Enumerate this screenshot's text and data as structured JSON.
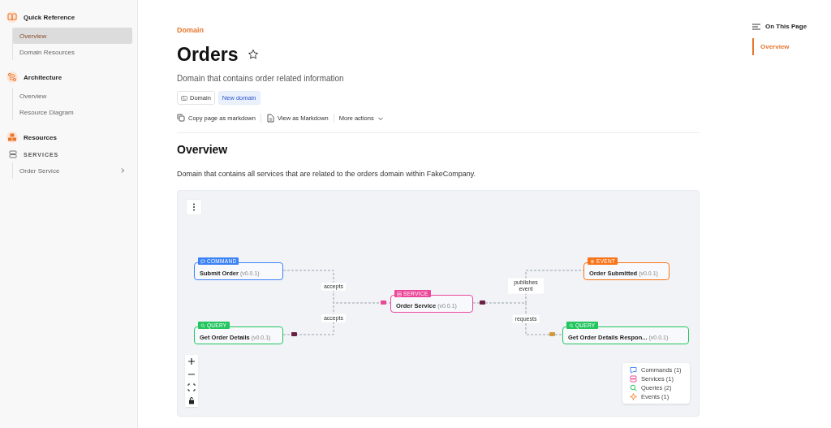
{
  "sidebar": {
    "sections": [
      {
        "kind": "book",
        "title": "Quick Reference",
        "items": [
          {
            "label": "Overview",
            "selected": true
          },
          {
            "label": "Domain Resources",
            "selected": false
          }
        ]
      },
      {
        "kind": "route",
        "title": "Architecture",
        "items": [
          {
            "label": "Overview",
            "selected": false
          },
          {
            "label": "Resource Diagram",
            "selected": false
          }
        ]
      },
      {
        "kind": "resources",
        "title": "Resources",
        "groups": [
          {
            "label": "SERVICES",
            "items": [
              {
                "label": "Order Service",
                "selected": false,
                "expanded": false
              }
            ]
          }
        ]
      }
    ]
  },
  "page": {
    "breadcrumb": "Domain",
    "title": "Orders",
    "starred": false,
    "description": "Domain that contains order related information",
    "tags": [
      {
        "kind": "outline",
        "label": "Domain"
      },
      {
        "kind": "highlight",
        "label": "New domain"
      }
    ],
    "actions": [
      {
        "kind": "copy",
        "label": "Copy page as markdown"
      },
      {
        "kind": "file",
        "label": "View as Markdown"
      },
      {
        "kind": "menu",
        "label": "More actions"
      }
    ],
    "section_heading": "Overview",
    "paragraph": "Domain that contains all services that are related to the orders domain within FakeCompany.",
    "diagram": {
      "nodes": [
        {
          "kind": "command",
          "badge": "COMMAND",
          "name": "Submit Order",
          "version": "(v0.0.1)"
        },
        {
          "kind": "query",
          "badge": "QUERY",
          "name": "Get Order Details",
          "version": "(v0.0.1)"
        },
        {
          "kind": "service",
          "badge": "SERVICE",
          "name": "Order Service",
          "version": "(v0.0.1)"
        },
        {
          "kind": "event",
          "badge": "EVENT",
          "name": "Order Submitted",
          "version": "(v0.0.1)"
        },
        {
          "kind": "query",
          "badge": "QUERY",
          "name": "Get Order Details Respon...",
          "version": "(v0.0.1)"
        }
      ],
      "edges": [
        {
          "label": "accepts"
        },
        {
          "label": "accepts"
        },
        {
          "label": "publishes event"
        },
        {
          "label": "requests"
        }
      ],
      "legend": [
        {
          "kind": "command",
          "label": "Commands (1)"
        },
        {
          "kind": "service",
          "label": "Services (1)"
        },
        {
          "kind": "query",
          "label": "Queries (2)"
        },
        {
          "kind": "event",
          "label": "Events (1)"
        }
      ]
    }
  },
  "toc": {
    "title": "On This Page",
    "items": [
      {
        "label": "Overview",
        "selected": true
      }
    ]
  }
}
